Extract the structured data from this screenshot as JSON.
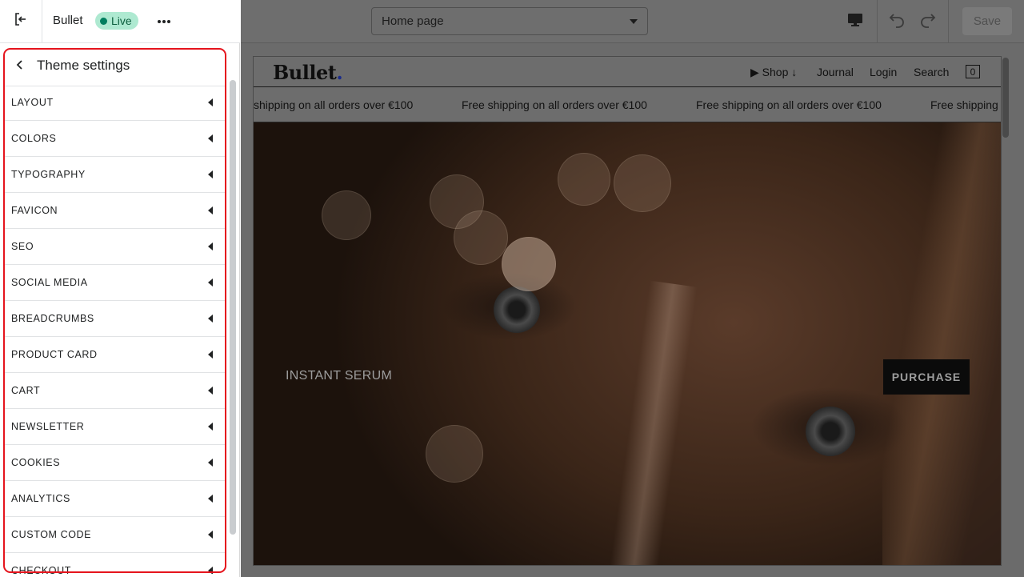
{
  "topbar": {
    "theme_name": "Bullet",
    "live_label": "Live",
    "exit_icon": "exit-icon",
    "more_icon": "more-horizontal-icon"
  },
  "panel": {
    "title": "Theme settings",
    "back_icon": "chevron-left-icon",
    "items": [
      {
        "label": "LAYOUT"
      },
      {
        "label": "COLORS"
      },
      {
        "label": "TYPOGRAPHY"
      },
      {
        "label": "FAVICON"
      },
      {
        "label": "SEO"
      },
      {
        "label": "SOCIAL MEDIA"
      },
      {
        "label": "BREADCRUMBS"
      },
      {
        "label": "PRODUCT CARD"
      },
      {
        "label": "CART"
      },
      {
        "label": "NEWSLETTER"
      },
      {
        "label": "COOKIES"
      },
      {
        "label": "ANALYTICS"
      },
      {
        "label": "CUSTOM CODE"
      },
      {
        "label": "CHECKOUT"
      }
    ]
  },
  "editor": {
    "page_select": "Home page",
    "save_label": "Save",
    "icons": [
      "desktop-icon",
      "undo-icon",
      "redo-icon"
    ]
  },
  "preview": {
    "logo": "Bullet",
    "logo_dot": ".",
    "nav": {
      "shop": "▶ Shop ↓",
      "journal": "Journal",
      "login": "Login",
      "search": "Search",
      "cart_count": "0"
    },
    "announcements": [
      "shipping on all orders over €100",
      "Free shipping on all orders over €100",
      "Free shipping on all orders over €100",
      "Free shipping"
    ],
    "hero": {
      "title": "INSTANT SERUM",
      "button": "PURCHASE"
    }
  },
  "colors": {
    "live_badge_bg": "#aee9d1",
    "live_dot": "#007f5f",
    "highlight_border": "#e5141d"
  }
}
